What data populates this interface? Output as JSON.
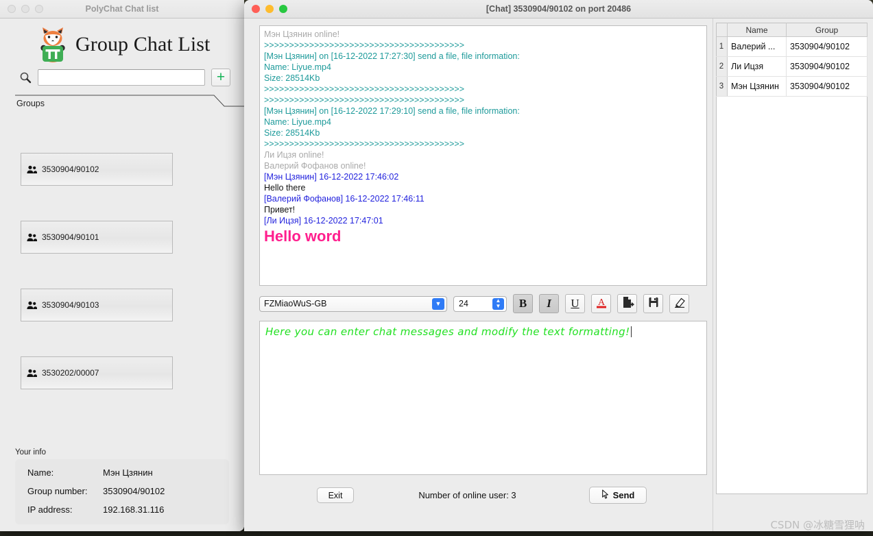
{
  "left_window": {
    "title": "PolyChat Chat list",
    "traffic_lights": [
      "close-inactive",
      "minimize-inactive",
      "maximize-inactive"
    ],
    "brand": {
      "title": "Group Chat List",
      "logo": "fox-pi-logo"
    },
    "search": {
      "value": "",
      "placeholder": "",
      "icon": "search-icon"
    },
    "add_button": {
      "label": "+",
      "name": "add-group-button"
    },
    "tab": {
      "label": "Groups"
    },
    "groups": [
      {
        "label": "3530904/90102"
      },
      {
        "label": "3530904/90101"
      },
      {
        "label": "3530904/90103"
      },
      {
        "label": "3530202/00007"
      }
    ],
    "your_info": {
      "title": "Your info",
      "rows": [
        {
          "key": "Name:",
          "value": "Мэн Цзянин"
        },
        {
          "key": "Group number:",
          "value": "3530904/90102"
        },
        {
          "key": "IP address:",
          "value": "192.168.31.116"
        }
      ]
    }
  },
  "chat_window": {
    "title": "[Chat] 3530904/90102 on port 20486",
    "traffic_lights": [
      "close",
      "minimize",
      "maximize"
    ],
    "log": [
      {
        "text": "Мэн Цзянин online!",
        "style": "gray"
      },
      {
        "text": ">>>>>>>>>>>>>>>>>>>>>>>>>>>>>>>>>>>>>>>>",
        "style": "teal"
      },
      {
        "text": "[Мэн Цзянин] on [16-12-2022 17:27:30] send a file, file information:",
        "style": "teal"
      },
      {
        "text": "Name: Liyue.mp4",
        "style": "teal"
      },
      {
        "text": "Size: 28514Kb",
        "style": "teal"
      },
      {
        "text": ">>>>>>>>>>>>>>>>>>>>>>>>>>>>>>>>>>>>>>>>",
        "style": "teal"
      },
      {
        "text": ">>>>>>>>>>>>>>>>>>>>>>>>>>>>>>>>>>>>>>>>",
        "style": "teal"
      },
      {
        "text": "[Мэн Цзянин] on [16-12-2022 17:29:10] send a file, file information:",
        "style": "teal"
      },
      {
        "text": "Name: Liyue.mp4",
        "style": "teal"
      },
      {
        "text": "Size: 28514Kb",
        "style": "teal"
      },
      {
        "text": ">>>>>>>>>>>>>>>>>>>>>>>>>>>>>>>>>>>>>>>>",
        "style": "teal"
      },
      {
        "text": "Ли Ицзя online!",
        "style": "gray"
      },
      {
        "text": "Валерий Фофанов online!",
        "style": "gray"
      },
      {
        "text": "[Мэн Цзянин] 16-12-2022 17:46:02",
        "style": "blue"
      },
      {
        "text": "Hello there",
        "style": "black"
      },
      {
        "text": "[Валерий Фофанов] 16-12-2022 17:46:11",
        "style": "blue"
      },
      {
        "text": "Привет!",
        "style": "black"
      },
      {
        "text": "[Ли Ицзя] 16-12-2022 17:47:01",
        "style": "blue"
      },
      {
        "text": "Hello word",
        "style": "pink"
      }
    ],
    "toolbar": {
      "font_family": "FZMiaoWuS-GB",
      "font_size": "24",
      "bold": "B",
      "italic": "I",
      "underline": "U",
      "text_color": "A",
      "send_file": "send-file-icon",
      "save": "save-icon",
      "clear": "eraser-icon"
    },
    "composer": {
      "text": "Here you can enter chat messages and modify the text formatting!"
    },
    "footer": {
      "exit_label": "Exit",
      "online_text": "Number of online user: 3",
      "send_label": "Send",
      "send_icon": "cursor-arrow-icon"
    },
    "user_table": {
      "columns": [
        "",
        "Name",
        "Group"
      ],
      "rows": [
        {
          "no": "1",
          "name": "Валерий ...",
          "group": "3530904/90102"
        },
        {
          "no": "2",
          "name": "Ли Ицзя",
          "group": "3530904/90102"
        },
        {
          "no": "3",
          "name": "Мэн Цзянин",
          "group": "3530904/90102"
        }
      ]
    }
  },
  "watermark": {
    "text": "CSDN @冰糖雪狸呐"
  },
  "colors": {
    "accent_blue": "#2f7bf6",
    "teal_text": "#1d9a9a",
    "blue_text": "#2222dd",
    "gray_text": "#a9a9a9",
    "pink_text": "#ff1f8e",
    "green_text": "#22e022",
    "add_green": "#14b356",
    "window_bg": "#ececec"
  }
}
